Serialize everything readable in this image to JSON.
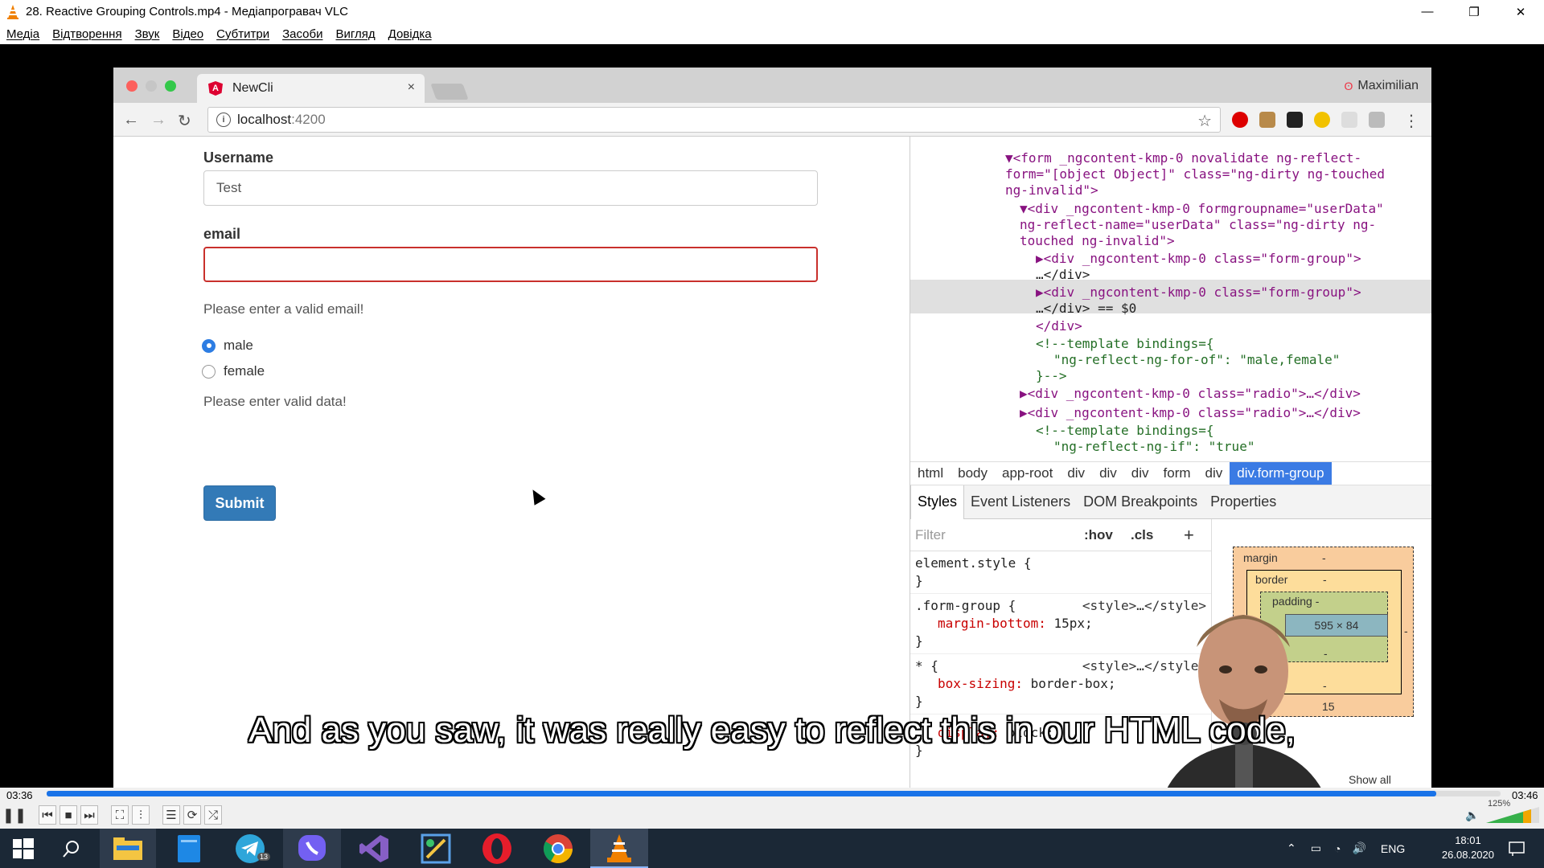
{
  "window": {
    "title": "28. Reactive Grouping Controls.mp4 - Медіапрогравач VLC",
    "minimize": "—",
    "restore": "❐",
    "close": "✕"
  },
  "menu": [
    "Медіа",
    "Відтворення",
    "Звук",
    "Відео",
    "Субтитри",
    "Засоби",
    "Вигляд",
    "Довідка"
  ],
  "browser": {
    "tab_title": "NewCli",
    "tab_close": "×",
    "profile": "Maximilian",
    "url_host": "localhost",
    "url_port": ":4200"
  },
  "form": {
    "username_label": "Username",
    "username_value": "Test",
    "email_label": "email",
    "email_value": "",
    "email_error": "Please enter a valid email!",
    "radio_male": "male",
    "radio_female": "female",
    "data_error": "Please enter valid data!",
    "submit": "Submit"
  },
  "devtools": {
    "dom_lines": [
      "▼<form _ngcontent-kmp-0 novalidate ng-reflect-",
      "form=\"[object Object]\" class=\"ng-dirty ng-touched",
      "ng-invalid\">",
      "▼<div _ngcontent-kmp-0 formgroupname=\"userData\"",
      "ng-reflect-name=\"userData\" class=\"ng-dirty ng-",
      "touched ng-invalid\">",
      "▶<div _ngcontent-kmp-0 class=\"form-group\">",
      "…</div>",
      "▶<div _ngcontent-kmp-0 class=\"form-group\">",
      "…</div> == $0",
      "</div>",
      "<!--template bindings={",
      "\"ng-reflect-ng-for-of\": \"male,female\"",
      "}-->",
      "▶<div _ngcontent-kmp-0 class=\"radio\">…</div>",
      "▶<div _ngcontent-kmp-0 class=\"radio\">…</div>",
      "<!--template bindings={",
      "\"ng-reflect-ng-if\": \"true\""
    ],
    "breadcrumbs": [
      "html",
      "body",
      "app-root",
      "div",
      "div",
      "div",
      "form",
      "div",
      "div.form-group"
    ],
    "style_tabs": [
      "Styles",
      "Event Listeners",
      "DOM Breakpoints",
      "Properties"
    ],
    "filter_placeholder": "Filter",
    "hov": ":hov",
    "cls": ".cls",
    "plus": "+",
    "rules": [
      {
        "selector": "element.style {",
        "source": "",
        "props": [],
        "close": "}"
      },
      {
        "selector": ".form-group {",
        "source": "<style>…</style>",
        "props": [
          {
            "name": "margin-bottom",
            "value": "15px;"
          }
        ],
        "close": "}"
      },
      {
        "selector": "* {",
        "source": "<style>…</style>",
        "props": [
          {
            "name": "box-sizing",
            "value": "border-box;"
          }
        ],
        "close": "}"
      },
      {
        "selector": "",
        "source": "",
        "props": [
          {
            "name": "display",
            "value": "block;"
          }
        ],
        "close": "}"
      }
    ],
    "boxmodel": {
      "margin": "margin",
      "margin_val": "-",
      "border": "border",
      "border_val": "-",
      "padding": "padding -",
      "content": "595 × 84",
      "padding_bottom": "-",
      "border_bottom": "-",
      "margin_bottom": "15",
      "side_dash": "-"
    },
    "show_all": "Show all"
  },
  "subtitle": "And as you saw, it was really easy to reflect this in our HTML code,",
  "player": {
    "elapsed": "03:36",
    "total": "03:46",
    "progress": 0.9558,
    "volume": "125%"
  },
  "taskbar": {
    "lang": "ENG",
    "time": "18:01",
    "date": "26.08.2020",
    "telegram_badge": "13"
  },
  "colors": {
    "accent": "#1a73e8",
    "taskbar": "#1b2836",
    "submit": "#337ab7",
    "error": "#c9302c"
  }
}
